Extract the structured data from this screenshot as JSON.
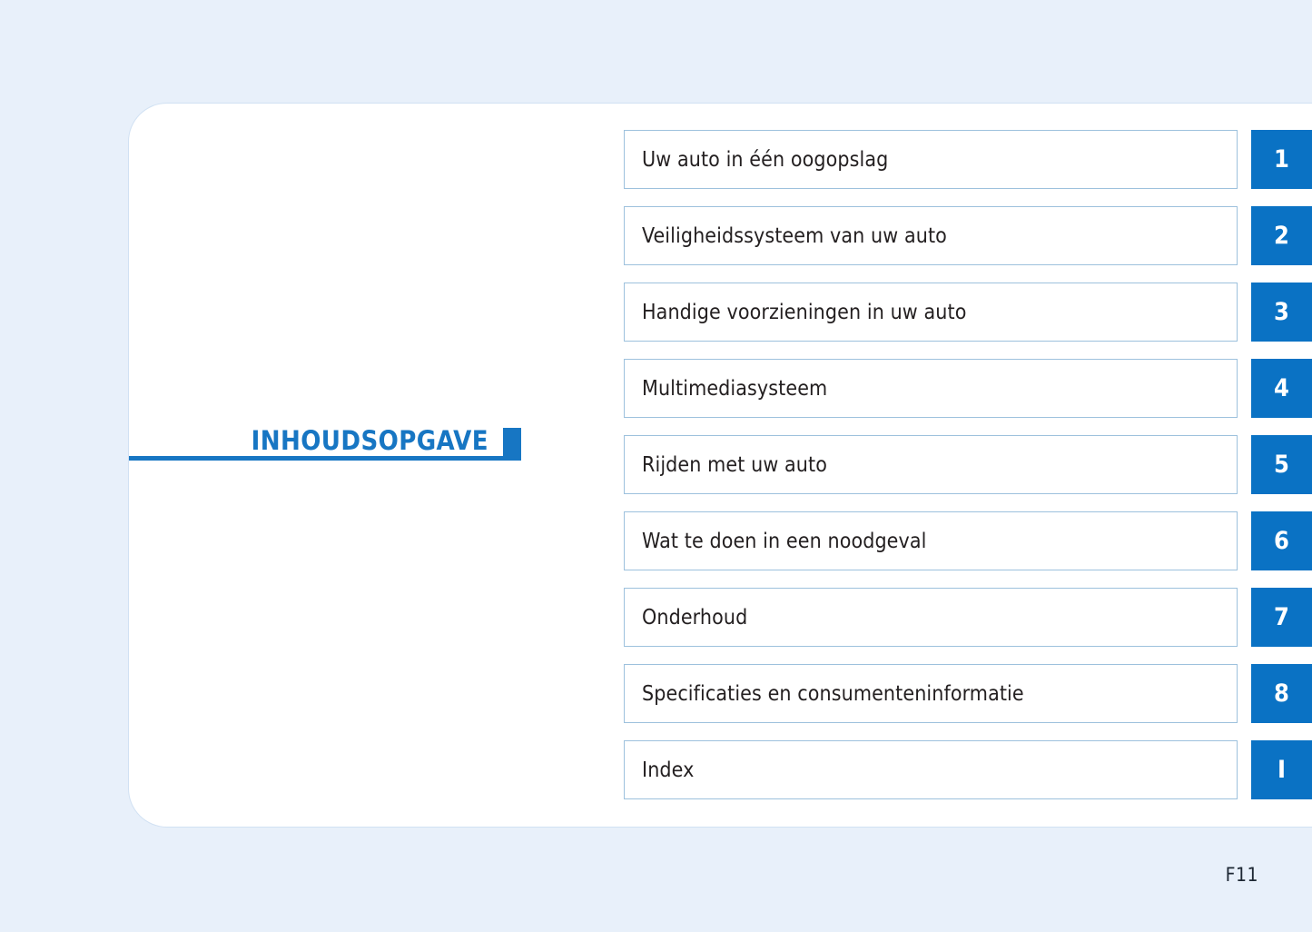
{
  "page": {
    "background_color": "#e8f0fa",
    "panel_color": "#ffffff",
    "accent_color": "#0a72c4",
    "title_color": "#1776c3",
    "folio": "F11"
  },
  "toc": {
    "title": "INHOUDSOPGAVE",
    "entries": [
      {
        "label": "Uw auto in één oogopslag",
        "tab": "1"
      },
      {
        "label": "Veiligheidssysteem van uw auto",
        "tab": "2"
      },
      {
        "label": "Handige voorzieningen in uw auto",
        "tab": "3"
      },
      {
        "label": "Multimediasysteem",
        "tab": "4"
      },
      {
        "label": "Rijden met uw auto",
        "tab": "5"
      },
      {
        "label": "Wat te doen in een noodgeval",
        "tab": "6"
      },
      {
        "label": "Onderhoud",
        "tab": "7"
      },
      {
        "label": "Specificaties en consumenteninformatie",
        "tab": "8"
      },
      {
        "label": "Index",
        "tab": "I"
      }
    ]
  }
}
